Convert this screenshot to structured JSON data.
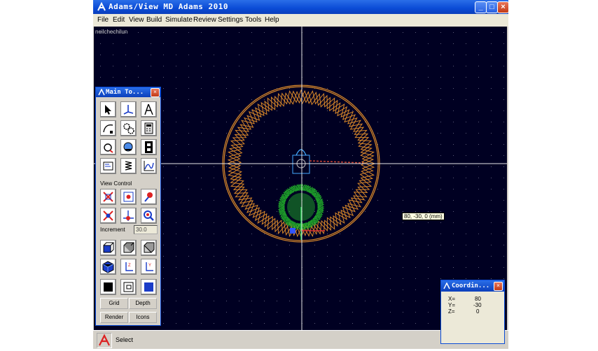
{
  "window": {
    "title": "Adams/View MD Adams 2010"
  },
  "menu": [
    "File",
    "Edit",
    "View",
    "Build",
    "Simulate",
    "Review",
    "Settings",
    "Tools",
    "Help"
  ],
  "viewport": {
    "model_name": "neilchechilun",
    "coord_tooltip": "80, -30, 0 (mm)"
  },
  "toolbox": {
    "title": "Main To...",
    "view_control_label": "View Control",
    "increment_label": "Increment",
    "increment_value": "30.0",
    "buttons": {
      "grid": "Grid",
      "depth": "Depth",
      "render": "Render",
      "icons": "Icons"
    }
  },
  "status": {
    "text": "Select"
  },
  "coord_window": {
    "title": "Coordin...",
    "x_label": "X=",
    "x": "80",
    "y_label": "Y=",
    "y": "-30",
    "z_label": "Z=",
    "z": "0"
  },
  "colors": {
    "background": "#000022",
    "ring_gear": "#d9882a",
    "sun_gear": "#1fa52a",
    "crosshair": "#e6e6e6"
  },
  "icons": [
    "select-arrow-icon",
    "coordinate-axes-icon",
    "measure-icon",
    "bezier-icon",
    "gears-icon",
    "calculator-icon",
    "rotate-icon",
    "refresh-icon",
    "film-icon",
    "screen-icon",
    "spring-icon",
    "plot-icon",
    "fit-icon",
    "translate-icon",
    "pick-icon",
    "zoom-rotate-icon",
    "center-icon",
    "zoom-icon"
  ]
}
